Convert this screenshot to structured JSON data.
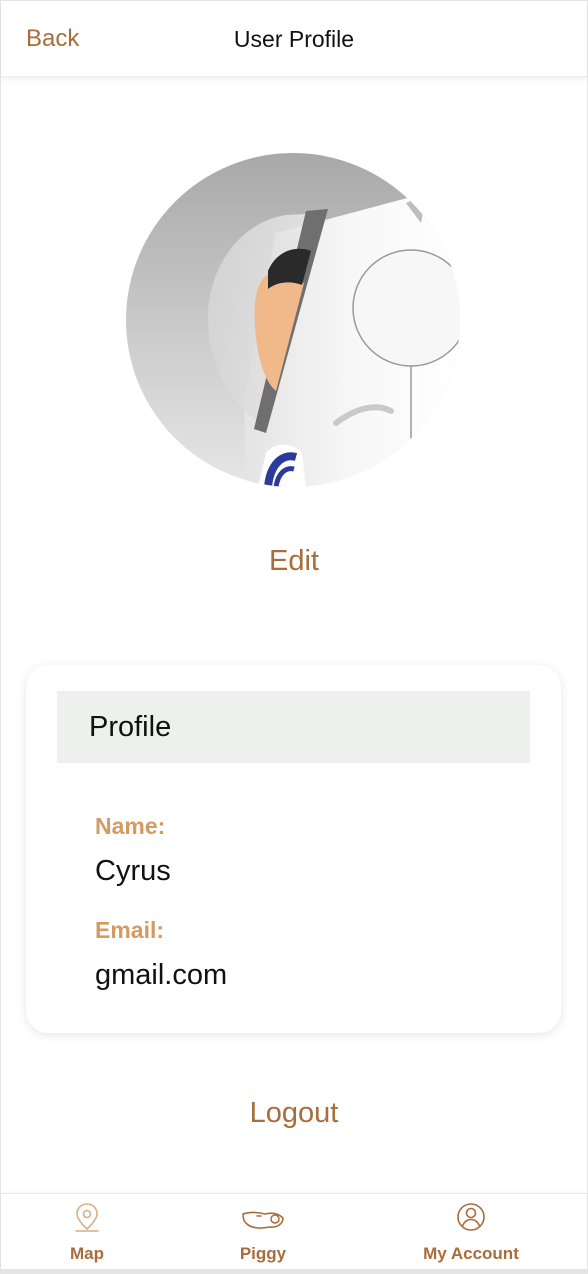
{
  "header": {
    "back_label": "Back",
    "title": "User Profile"
  },
  "avatar": {
    "icon": "astronaut-avatar-image"
  },
  "actions": {
    "edit_label": "Edit",
    "logout_label": "Logout"
  },
  "profile_card": {
    "title": "Profile",
    "name_label": "Name:",
    "name_value": "Cyrus",
    "email_label": "Email:",
    "email_value": "gmail.com"
  },
  "bottom_nav": {
    "items": [
      {
        "label": "Map",
        "icon": "map-pin-icon"
      },
      {
        "label": "Piggy",
        "icon": "piggy-bank-icon"
      },
      {
        "label": "My Account",
        "icon": "account-icon",
        "active": true
      }
    ]
  },
  "colors": {
    "accent": "#a86d3a",
    "label_accent": "#d39a62",
    "card_header_bg": "#eef0ee",
    "icon_stroke": "#d8ae88"
  }
}
